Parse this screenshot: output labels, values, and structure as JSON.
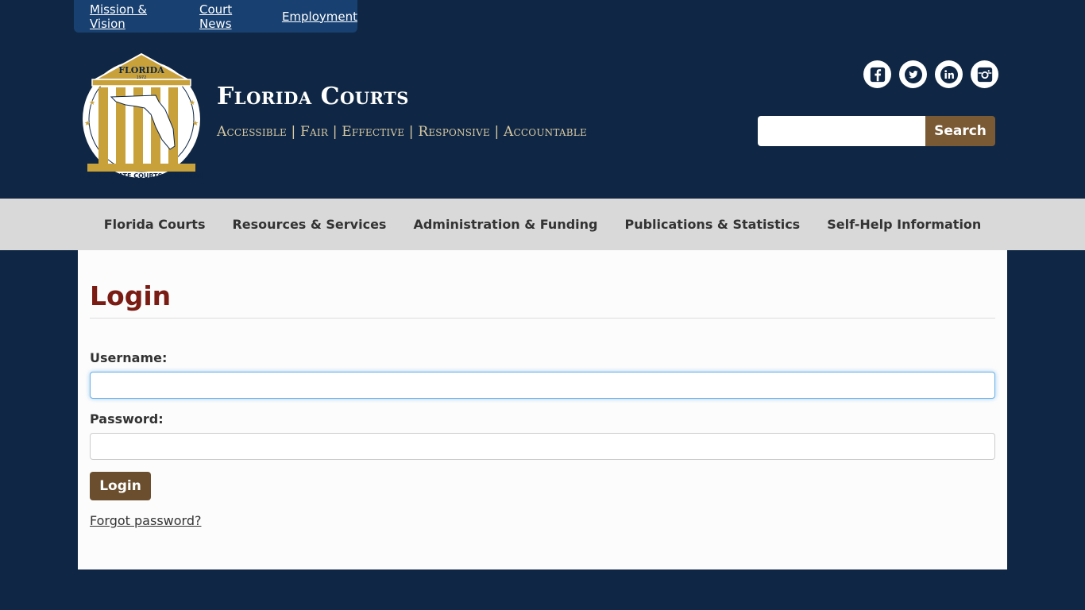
{
  "utility_nav": {
    "items": [
      "Mission & Vision",
      "Court News",
      "Employment"
    ]
  },
  "brand": {
    "title": "Florida Courts",
    "tagline": "Accessible | Fair | Effective | Responsive | Accountable",
    "seal_text_top": "FLORIDA",
    "seal_year": "1972",
    "seal_text_ring": "OFFICE of the STATE COURTS ADMINISTRATOR"
  },
  "social": {
    "icons": [
      "facebook-icon",
      "twitter-icon",
      "linkedin-icon",
      "instagram-icon"
    ]
  },
  "search": {
    "placeholder": "",
    "button_label": "Search"
  },
  "main_nav": {
    "items": [
      "Florida Courts",
      "Resources & Services",
      "Administration & Funding",
      "Publications & Statistics",
      "Self-Help Information"
    ]
  },
  "login_form": {
    "title": "Login",
    "username_label": "Username:",
    "username_value": "",
    "password_label": "Password:",
    "password_value": "",
    "submit_label": "Login",
    "forgot_label": "Forgot password?"
  },
  "colors": {
    "header_bg": "#0f2744",
    "utility_bg": "#184070",
    "accent_brown": "#7a5a34",
    "title_red": "#7a1c14",
    "nav_bg": "#d9d9d9",
    "seal_gold": "#c9a13b"
  }
}
